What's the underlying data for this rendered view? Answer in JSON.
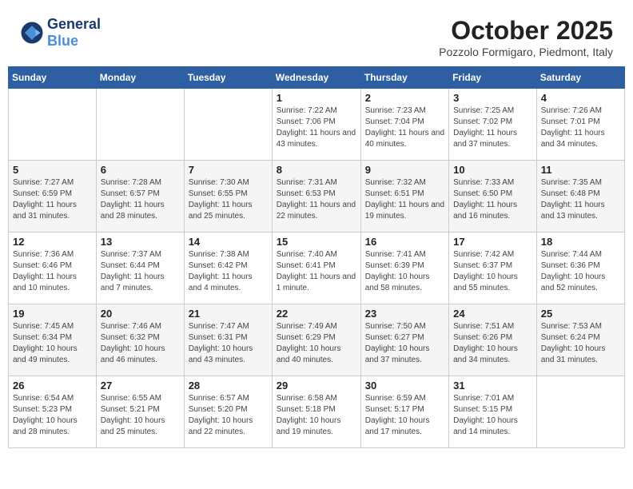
{
  "logo": {
    "general": "General",
    "blue": "Blue"
  },
  "title": "October 2025",
  "subtitle": "Pozzolo Formigaro, Piedmont, Italy",
  "days_of_week": [
    "Sunday",
    "Monday",
    "Tuesday",
    "Wednesday",
    "Thursday",
    "Friday",
    "Saturday"
  ],
  "weeks": [
    [
      {
        "day": "",
        "info": ""
      },
      {
        "day": "",
        "info": ""
      },
      {
        "day": "",
        "info": ""
      },
      {
        "day": "1",
        "info": "Sunrise: 7:22 AM\nSunset: 7:06 PM\nDaylight: 11 hours and 43 minutes."
      },
      {
        "day": "2",
        "info": "Sunrise: 7:23 AM\nSunset: 7:04 PM\nDaylight: 11 hours and 40 minutes."
      },
      {
        "day": "3",
        "info": "Sunrise: 7:25 AM\nSunset: 7:02 PM\nDaylight: 11 hours and 37 minutes."
      },
      {
        "day": "4",
        "info": "Sunrise: 7:26 AM\nSunset: 7:01 PM\nDaylight: 11 hours and 34 minutes."
      }
    ],
    [
      {
        "day": "5",
        "info": "Sunrise: 7:27 AM\nSunset: 6:59 PM\nDaylight: 11 hours and 31 minutes."
      },
      {
        "day": "6",
        "info": "Sunrise: 7:28 AM\nSunset: 6:57 PM\nDaylight: 11 hours and 28 minutes."
      },
      {
        "day": "7",
        "info": "Sunrise: 7:30 AM\nSunset: 6:55 PM\nDaylight: 11 hours and 25 minutes."
      },
      {
        "day": "8",
        "info": "Sunrise: 7:31 AM\nSunset: 6:53 PM\nDaylight: 11 hours and 22 minutes."
      },
      {
        "day": "9",
        "info": "Sunrise: 7:32 AM\nSunset: 6:51 PM\nDaylight: 11 hours and 19 minutes."
      },
      {
        "day": "10",
        "info": "Sunrise: 7:33 AM\nSunset: 6:50 PM\nDaylight: 11 hours and 16 minutes."
      },
      {
        "day": "11",
        "info": "Sunrise: 7:35 AM\nSunset: 6:48 PM\nDaylight: 11 hours and 13 minutes."
      }
    ],
    [
      {
        "day": "12",
        "info": "Sunrise: 7:36 AM\nSunset: 6:46 PM\nDaylight: 11 hours and 10 minutes."
      },
      {
        "day": "13",
        "info": "Sunrise: 7:37 AM\nSunset: 6:44 PM\nDaylight: 11 hours and 7 minutes."
      },
      {
        "day": "14",
        "info": "Sunrise: 7:38 AM\nSunset: 6:42 PM\nDaylight: 11 hours and 4 minutes."
      },
      {
        "day": "15",
        "info": "Sunrise: 7:40 AM\nSunset: 6:41 PM\nDaylight: 11 hours and 1 minute."
      },
      {
        "day": "16",
        "info": "Sunrise: 7:41 AM\nSunset: 6:39 PM\nDaylight: 10 hours and 58 minutes."
      },
      {
        "day": "17",
        "info": "Sunrise: 7:42 AM\nSunset: 6:37 PM\nDaylight: 10 hours and 55 minutes."
      },
      {
        "day": "18",
        "info": "Sunrise: 7:44 AM\nSunset: 6:36 PM\nDaylight: 10 hours and 52 minutes."
      }
    ],
    [
      {
        "day": "19",
        "info": "Sunrise: 7:45 AM\nSunset: 6:34 PM\nDaylight: 10 hours and 49 minutes."
      },
      {
        "day": "20",
        "info": "Sunrise: 7:46 AM\nSunset: 6:32 PM\nDaylight: 10 hours and 46 minutes."
      },
      {
        "day": "21",
        "info": "Sunrise: 7:47 AM\nSunset: 6:31 PM\nDaylight: 10 hours and 43 minutes."
      },
      {
        "day": "22",
        "info": "Sunrise: 7:49 AM\nSunset: 6:29 PM\nDaylight: 10 hours and 40 minutes."
      },
      {
        "day": "23",
        "info": "Sunrise: 7:50 AM\nSunset: 6:27 PM\nDaylight: 10 hours and 37 minutes."
      },
      {
        "day": "24",
        "info": "Sunrise: 7:51 AM\nSunset: 6:26 PM\nDaylight: 10 hours and 34 minutes."
      },
      {
        "day": "25",
        "info": "Sunrise: 7:53 AM\nSunset: 6:24 PM\nDaylight: 10 hours and 31 minutes."
      }
    ],
    [
      {
        "day": "26",
        "info": "Sunrise: 6:54 AM\nSunset: 5:23 PM\nDaylight: 10 hours and 28 minutes."
      },
      {
        "day": "27",
        "info": "Sunrise: 6:55 AM\nSunset: 5:21 PM\nDaylight: 10 hours and 25 minutes."
      },
      {
        "day": "28",
        "info": "Sunrise: 6:57 AM\nSunset: 5:20 PM\nDaylight: 10 hours and 22 minutes."
      },
      {
        "day": "29",
        "info": "Sunrise: 6:58 AM\nSunset: 5:18 PM\nDaylight: 10 hours and 19 minutes."
      },
      {
        "day": "30",
        "info": "Sunrise: 6:59 AM\nSunset: 5:17 PM\nDaylight: 10 hours and 17 minutes."
      },
      {
        "day": "31",
        "info": "Sunrise: 7:01 AM\nSunset: 5:15 PM\nDaylight: 10 hours and 14 minutes."
      },
      {
        "day": "",
        "info": ""
      }
    ]
  ]
}
